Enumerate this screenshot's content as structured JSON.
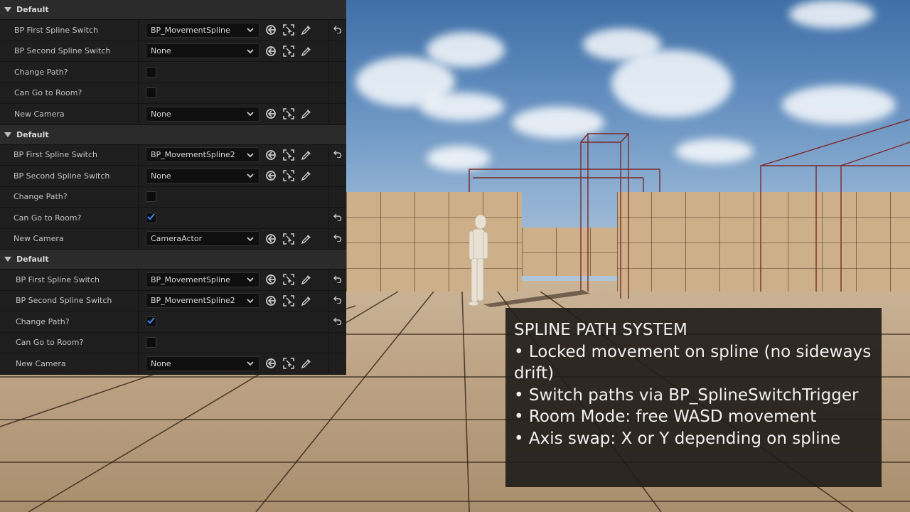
{
  "details_panel": {
    "sections": [
      {
        "header": "Default",
        "rows": [
          {
            "label": "BP First Spline Switch",
            "type": "combo",
            "value": "BP_MovementSpline",
            "reset": true
          },
          {
            "label": "BP Second Spline Switch",
            "type": "combo",
            "value": "None",
            "reset": false
          },
          {
            "label": "Change Path?",
            "type": "checkbox",
            "checked": false,
            "reset": false
          },
          {
            "label": "Can Go to Room?",
            "type": "checkbox",
            "checked": false,
            "reset": false
          },
          {
            "label": "New Camera",
            "type": "combo",
            "value": "None",
            "reset": false
          }
        ]
      },
      {
        "header": "Default",
        "rows": [
          {
            "label": "BP First Spline Switch",
            "type": "combo",
            "value": "BP_MovementSpline2",
            "reset": true
          },
          {
            "label": "BP Second Spline Switch",
            "type": "combo",
            "value": "None",
            "reset": false
          },
          {
            "label": "Change Path?",
            "type": "checkbox",
            "checked": false,
            "reset": false
          },
          {
            "label": "Can Go to Room?",
            "type": "checkbox",
            "checked": true,
            "reset": true
          },
          {
            "label": "New Camera",
            "type": "combo",
            "value": "CameraActor",
            "reset": true
          }
        ]
      },
      {
        "header": "Default",
        "rows": [
          {
            "label": "BP First Spline Switch",
            "type": "combo",
            "value": "BP_MovementSpline",
            "reset": true
          },
          {
            "label": "BP Second Spline Switch",
            "type": "combo",
            "value": "BP_MovementSpline2",
            "reset": true
          },
          {
            "label": "Change Path?",
            "type": "checkbox",
            "checked": true,
            "reset": true
          },
          {
            "label": "Can Go to Room?",
            "type": "checkbox",
            "checked": false,
            "reset": false
          },
          {
            "label": "New Camera",
            "type": "combo",
            "value": "None",
            "reset": false
          }
        ]
      }
    ],
    "tool_icons": [
      "browse-to-asset-icon",
      "use-selected-icon",
      "pick-actor-icon"
    ],
    "colors": {
      "panel_bg": "#1a1a1a",
      "row_bg": "#1e1e1e",
      "section_bg": "#2b2b2b",
      "check_blue": "#3d8bff"
    }
  },
  "info_box": {
    "title": "SPLINE PATH SYSTEM",
    "lines": [
      "• Locked movement on spline (no sideways drift)",
      "• Switch paths via BP_SplineSwitchTrigger",
      "• Room Mode: free WASD movement",
      "• Axis swap: X or Y depending on spline"
    ]
  }
}
